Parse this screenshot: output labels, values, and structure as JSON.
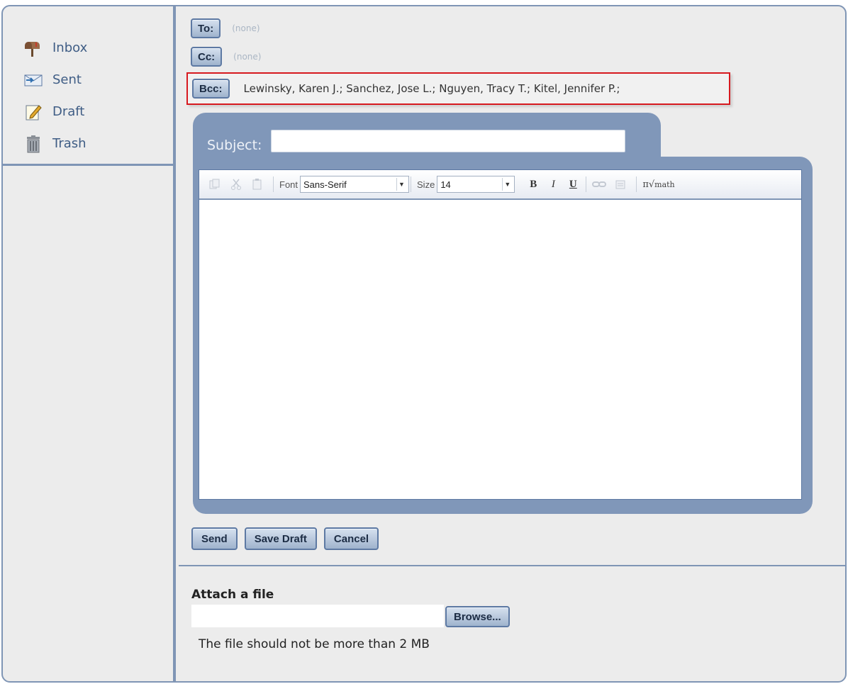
{
  "sidebar": {
    "items": [
      {
        "label": "Inbox",
        "icon": "mailbox-icon"
      },
      {
        "label": "Sent",
        "icon": "sent-mail-icon"
      },
      {
        "label": "Draft",
        "icon": "draft-icon"
      },
      {
        "label": "Trash",
        "icon": "trash-icon"
      }
    ]
  },
  "compose": {
    "to": {
      "label": "To:",
      "value": "(none)"
    },
    "cc": {
      "label": "Cc:",
      "value": "(none)"
    },
    "bcc": {
      "label": "Bcc:",
      "value": "Lewinsky, Karen J.; Sanchez, Jose L.; Nguyen, Tracy T.; Kitel, Jennifer P.;"
    },
    "subject": {
      "label": "Subject:",
      "value": ""
    },
    "editor": {
      "font_label": "Font",
      "font_value": "Sans-Serif",
      "size_label": "Size",
      "size_value": "14",
      "bold": "B",
      "italic": "I",
      "underline": "U",
      "math_label": "math",
      "math_symbol": "π√",
      "body": ""
    },
    "actions": {
      "send": "Send",
      "save_draft": "Save Draft",
      "cancel": "Cancel"
    }
  },
  "attachment": {
    "title": "Attach a file",
    "file_value": "",
    "browse": "Browse...",
    "note": "The file should not be more than 2 MB"
  },
  "colors": {
    "panel": "#8097b9",
    "border": "#7f95b5",
    "highlight": "#d7191f",
    "background": "#ececec"
  }
}
